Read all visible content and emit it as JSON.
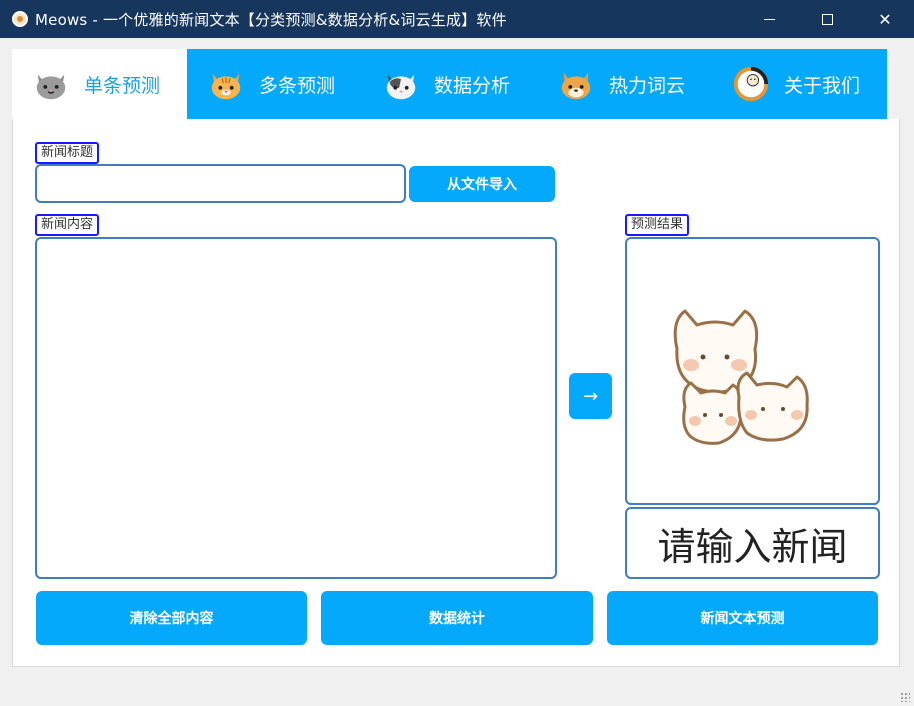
{
  "window": {
    "title": "Meows - 一个优雅的新闻文本【分类预测&数据分析&词云生成】软件",
    "minimize_icon": "minimize-icon",
    "maximize_icon": "maximize-icon",
    "close_glyph": "✕"
  },
  "tabs": [
    {
      "label": "单条预测",
      "icon": "gray-cat-icon",
      "active": true
    },
    {
      "label": "多条预测",
      "icon": "orange-tabby-cat-icon",
      "active": false
    },
    {
      "label": "数据分析",
      "icon": "calico-cat-icon",
      "active": false
    },
    {
      "label": "热力词云",
      "icon": "shiba-dog-icon",
      "active": false
    },
    {
      "label": "关于我们",
      "icon": "cat-logo-icon",
      "active": false
    }
  ],
  "form": {
    "title_label": "新闻标题",
    "title_value": "",
    "import_button": "从文件导入",
    "content_label": "新闻内容",
    "content_value": "",
    "arrow_glyph": "→",
    "result_label": "预测结果",
    "result_image": "three-kittens-illustration",
    "result_text": "请输入新闻"
  },
  "actions": {
    "clear": "清除全部内容",
    "stats": "数据统计",
    "predict": "新闻文本预测"
  },
  "colors": {
    "titlebar": "#17365d",
    "accent": "#05a9fb",
    "field_border": "#3e7cc4",
    "label_border": "#1a1aff"
  }
}
